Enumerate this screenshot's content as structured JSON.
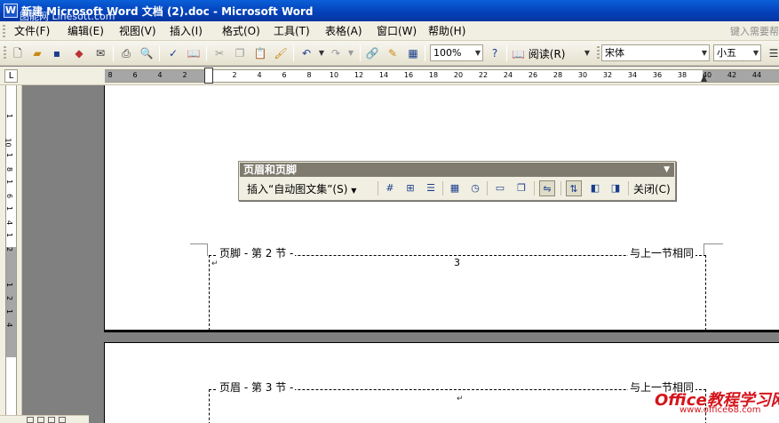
{
  "window": {
    "title": "新建 Microsoft Word 文档 (2).doc - Microsoft Word",
    "overlay_watermark": "图能网 Linesott.com"
  },
  "menubar": {
    "items": [
      "文件(F)",
      "编辑(E)",
      "视图(V)",
      "插入(I)",
      "格式(O)",
      "工具(T)",
      "表格(A)",
      "窗口(W)",
      "帮助(H)"
    ],
    "ask_placeholder": "键入需要帮"
  },
  "toolbar": {
    "zoom": "100%",
    "read_label": "阅读(R)",
    "font_name": "宋体",
    "font_size": "小五"
  },
  "ruler": {
    "numbers": [
      "8",
      "6",
      "4",
      "2",
      "2",
      "4",
      "6",
      "8",
      "10",
      "12",
      "14",
      "16",
      "18",
      "20",
      "22",
      "24",
      "26",
      "28",
      "30",
      "32",
      "34",
      "36",
      "38",
      "40",
      "42",
      "44"
    ],
    "vnumbers": [
      "1",
      "10",
      "1",
      "8",
      "1",
      "6",
      "1",
      "4",
      "1",
      "2",
      "1",
      "2",
      "1",
      "4"
    ]
  },
  "header_footer_toolbar": {
    "title": "页眉和页脚",
    "insert_autotext": "插入“自动图文集”(S)",
    "close": "关闭(C)"
  },
  "page1": {
    "footer_label": "页脚 - 第 2 节 -",
    "same_as_previous": "与上一节相同",
    "page_number": "3"
  },
  "page2": {
    "header_label": "页眉 - 第 3 节 -",
    "same_as_previous": "与上一节相同"
  },
  "site_watermark": {
    "brand": "Office教程学习网",
    "url": "www.office68.com"
  }
}
